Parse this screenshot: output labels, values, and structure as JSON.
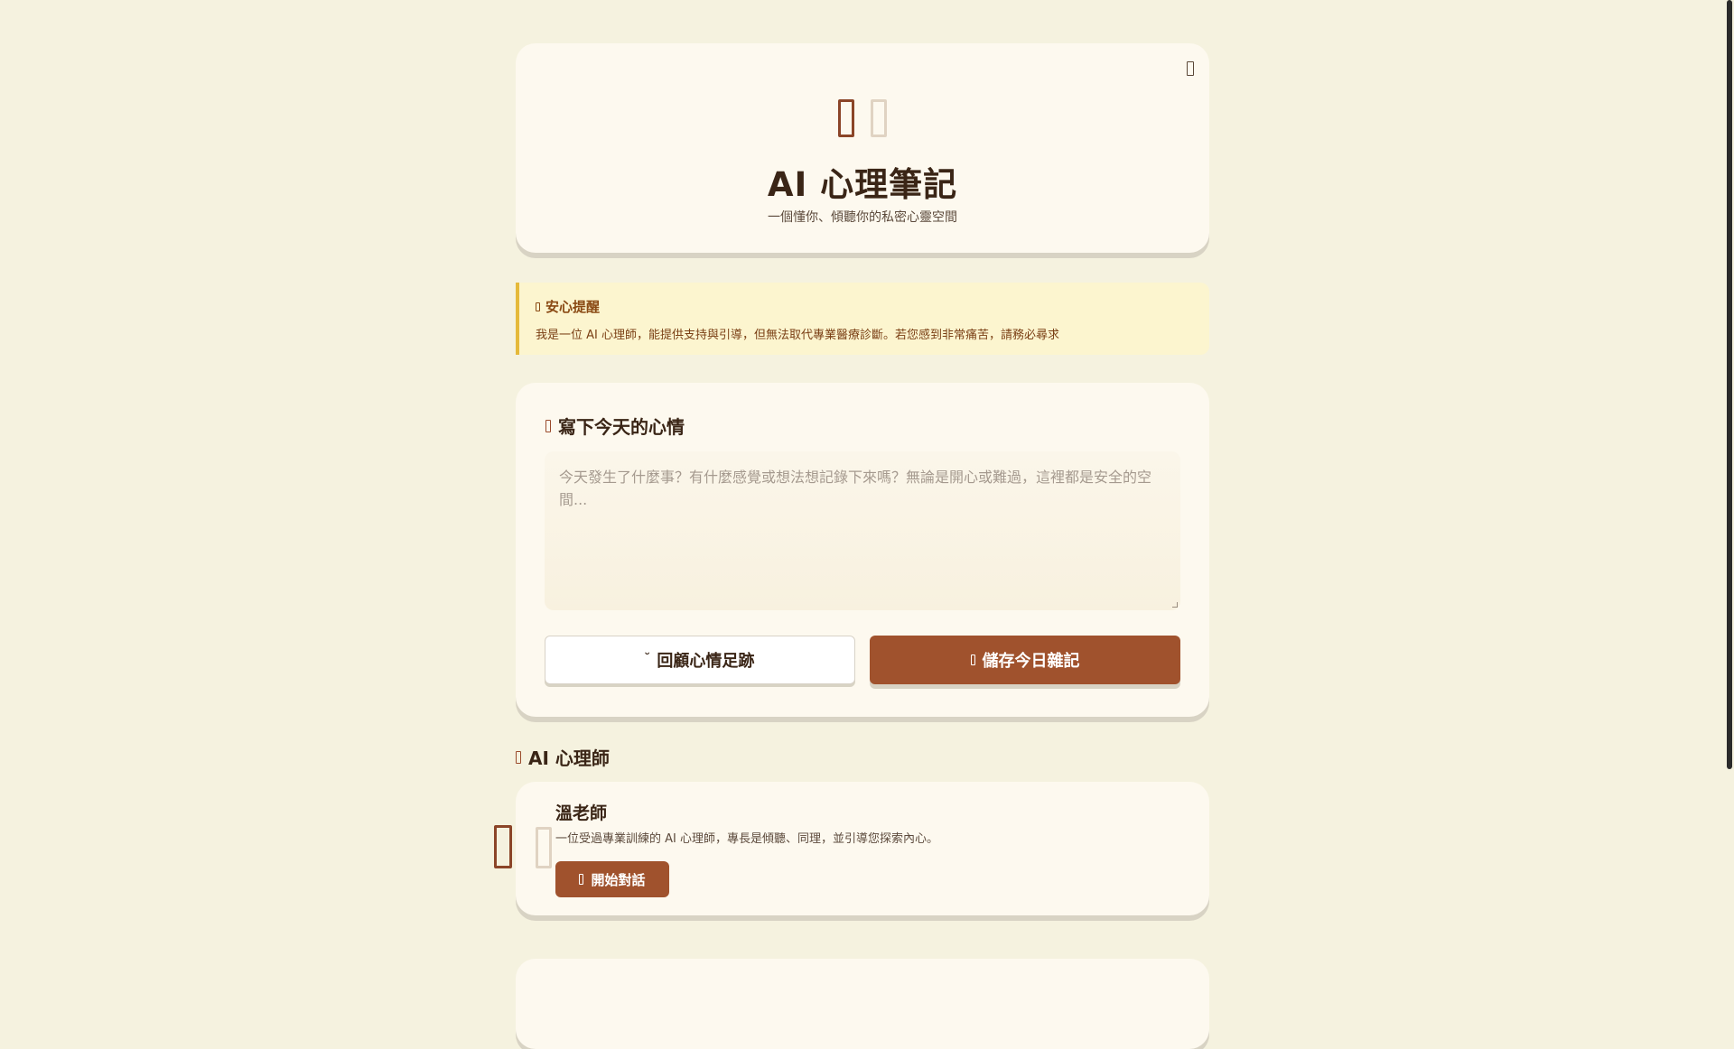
{
  "header": {
    "title": "AI 心理筆記",
    "subtitle": "一個懂你、傾聽你的私密心靈空間",
    "logo_icons": [
      "journal-icon",
      "leaf-icon"
    ],
    "corner_icon": "theme-toggle-icon"
  },
  "notice": {
    "title": "安心提醒",
    "text": "我是一位 AI 心理師，能提供支持與引導，但無法取代專業醫療診斷。若您感到非常痛苦，請務必尋求"
  },
  "journal": {
    "section_title": "寫下今天的心情",
    "placeholder": "今天發生了什麼事？有什麼感覺或想法想記錄下來嗎？無論是開心或難過，這裡都是安全的空間...",
    "value": "",
    "review_button": "回顧心情足跡",
    "review_caret": "˘",
    "save_button": "儲存今日雜記"
  },
  "therapist": {
    "section_title": "AI 心理師",
    "name": "溫老師",
    "description": "一位受過專業訓練的 AI 心理師，專長是傾聽、同理，並引導您探索內心。",
    "chat_button": "開始對話"
  },
  "colors": {
    "background": "#f5f2df",
    "card": "#fdf9ef",
    "accent": "#a0522d",
    "notice_bg": "#fcf5cf",
    "notice_border": "#e5b93a",
    "text": "#3a2516"
  }
}
